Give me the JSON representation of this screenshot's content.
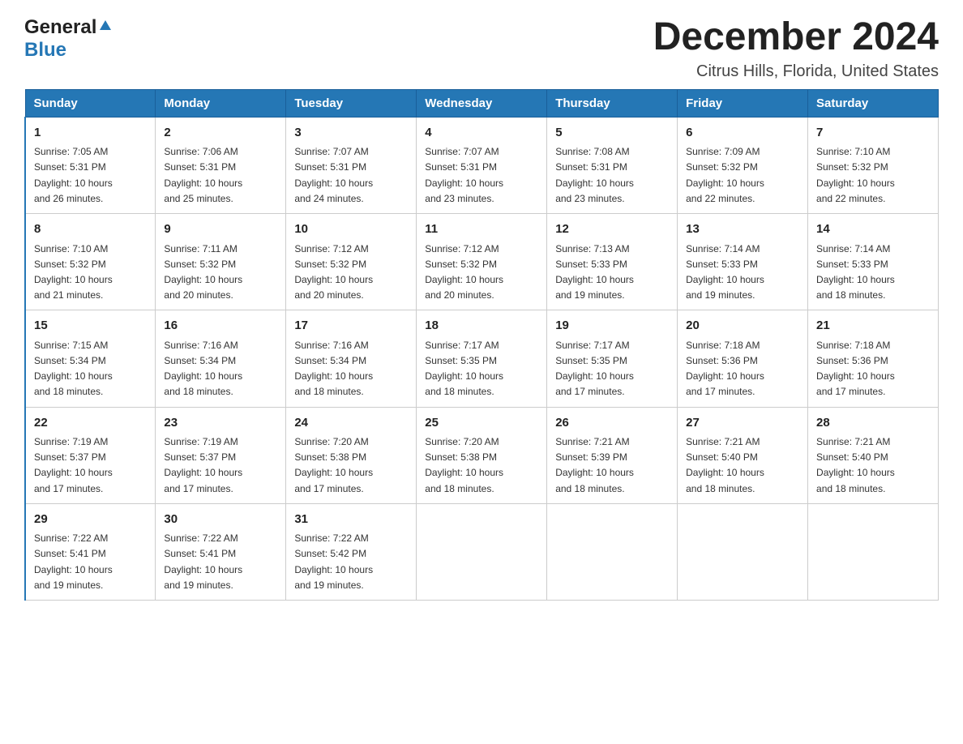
{
  "logo": {
    "general": "General",
    "blue": "Blue",
    "arrow": "▲"
  },
  "title": {
    "month_year": "December 2024",
    "location": "Citrus Hills, Florida, United States"
  },
  "days_of_week": [
    "Sunday",
    "Monday",
    "Tuesday",
    "Wednesday",
    "Thursday",
    "Friday",
    "Saturday"
  ],
  "weeks": [
    [
      {
        "day": "1",
        "sunrise": "7:05 AM",
        "sunset": "5:31 PM",
        "daylight": "10 hours and 26 minutes."
      },
      {
        "day": "2",
        "sunrise": "7:06 AM",
        "sunset": "5:31 PM",
        "daylight": "10 hours and 25 minutes."
      },
      {
        "day": "3",
        "sunrise": "7:07 AM",
        "sunset": "5:31 PM",
        "daylight": "10 hours and 24 minutes."
      },
      {
        "day": "4",
        "sunrise": "7:07 AM",
        "sunset": "5:31 PM",
        "daylight": "10 hours and 23 minutes."
      },
      {
        "day": "5",
        "sunrise": "7:08 AM",
        "sunset": "5:31 PM",
        "daylight": "10 hours and 23 minutes."
      },
      {
        "day": "6",
        "sunrise": "7:09 AM",
        "sunset": "5:32 PM",
        "daylight": "10 hours and 22 minutes."
      },
      {
        "day": "7",
        "sunrise": "7:10 AM",
        "sunset": "5:32 PM",
        "daylight": "10 hours and 22 minutes."
      }
    ],
    [
      {
        "day": "8",
        "sunrise": "7:10 AM",
        "sunset": "5:32 PM",
        "daylight": "10 hours and 21 minutes."
      },
      {
        "day": "9",
        "sunrise": "7:11 AM",
        "sunset": "5:32 PM",
        "daylight": "10 hours and 20 minutes."
      },
      {
        "day": "10",
        "sunrise": "7:12 AM",
        "sunset": "5:32 PM",
        "daylight": "10 hours and 20 minutes."
      },
      {
        "day": "11",
        "sunrise": "7:12 AM",
        "sunset": "5:32 PM",
        "daylight": "10 hours and 20 minutes."
      },
      {
        "day": "12",
        "sunrise": "7:13 AM",
        "sunset": "5:33 PM",
        "daylight": "10 hours and 19 minutes."
      },
      {
        "day": "13",
        "sunrise": "7:14 AM",
        "sunset": "5:33 PM",
        "daylight": "10 hours and 19 minutes."
      },
      {
        "day": "14",
        "sunrise": "7:14 AM",
        "sunset": "5:33 PM",
        "daylight": "10 hours and 18 minutes."
      }
    ],
    [
      {
        "day": "15",
        "sunrise": "7:15 AM",
        "sunset": "5:34 PM",
        "daylight": "10 hours and 18 minutes."
      },
      {
        "day": "16",
        "sunrise": "7:16 AM",
        "sunset": "5:34 PM",
        "daylight": "10 hours and 18 minutes."
      },
      {
        "day": "17",
        "sunrise": "7:16 AM",
        "sunset": "5:34 PM",
        "daylight": "10 hours and 18 minutes."
      },
      {
        "day": "18",
        "sunrise": "7:17 AM",
        "sunset": "5:35 PM",
        "daylight": "10 hours and 18 minutes."
      },
      {
        "day": "19",
        "sunrise": "7:17 AM",
        "sunset": "5:35 PM",
        "daylight": "10 hours and 17 minutes."
      },
      {
        "day": "20",
        "sunrise": "7:18 AM",
        "sunset": "5:36 PM",
        "daylight": "10 hours and 17 minutes."
      },
      {
        "day": "21",
        "sunrise": "7:18 AM",
        "sunset": "5:36 PM",
        "daylight": "10 hours and 17 minutes."
      }
    ],
    [
      {
        "day": "22",
        "sunrise": "7:19 AM",
        "sunset": "5:37 PM",
        "daylight": "10 hours and 17 minutes."
      },
      {
        "day": "23",
        "sunrise": "7:19 AM",
        "sunset": "5:37 PM",
        "daylight": "10 hours and 17 minutes."
      },
      {
        "day": "24",
        "sunrise": "7:20 AM",
        "sunset": "5:38 PM",
        "daylight": "10 hours and 17 minutes."
      },
      {
        "day": "25",
        "sunrise": "7:20 AM",
        "sunset": "5:38 PM",
        "daylight": "10 hours and 18 minutes."
      },
      {
        "day": "26",
        "sunrise": "7:21 AM",
        "sunset": "5:39 PM",
        "daylight": "10 hours and 18 minutes."
      },
      {
        "day": "27",
        "sunrise": "7:21 AM",
        "sunset": "5:40 PM",
        "daylight": "10 hours and 18 minutes."
      },
      {
        "day": "28",
        "sunrise": "7:21 AM",
        "sunset": "5:40 PM",
        "daylight": "10 hours and 18 minutes."
      }
    ],
    [
      {
        "day": "29",
        "sunrise": "7:22 AM",
        "sunset": "5:41 PM",
        "daylight": "10 hours and 19 minutes."
      },
      {
        "day": "30",
        "sunrise": "7:22 AM",
        "sunset": "5:41 PM",
        "daylight": "10 hours and 19 minutes."
      },
      {
        "day": "31",
        "sunrise": "7:22 AM",
        "sunset": "5:42 PM",
        "daylight": "10 hours and 19 minutes."
      },
      null,
      null,
      null,
      null
    ]
  ],
  "labels": {
    "sunrise": "Sunrise:",
    "sunset": "Sunset:",
    "daylight": "Daylight:"
  }
}
